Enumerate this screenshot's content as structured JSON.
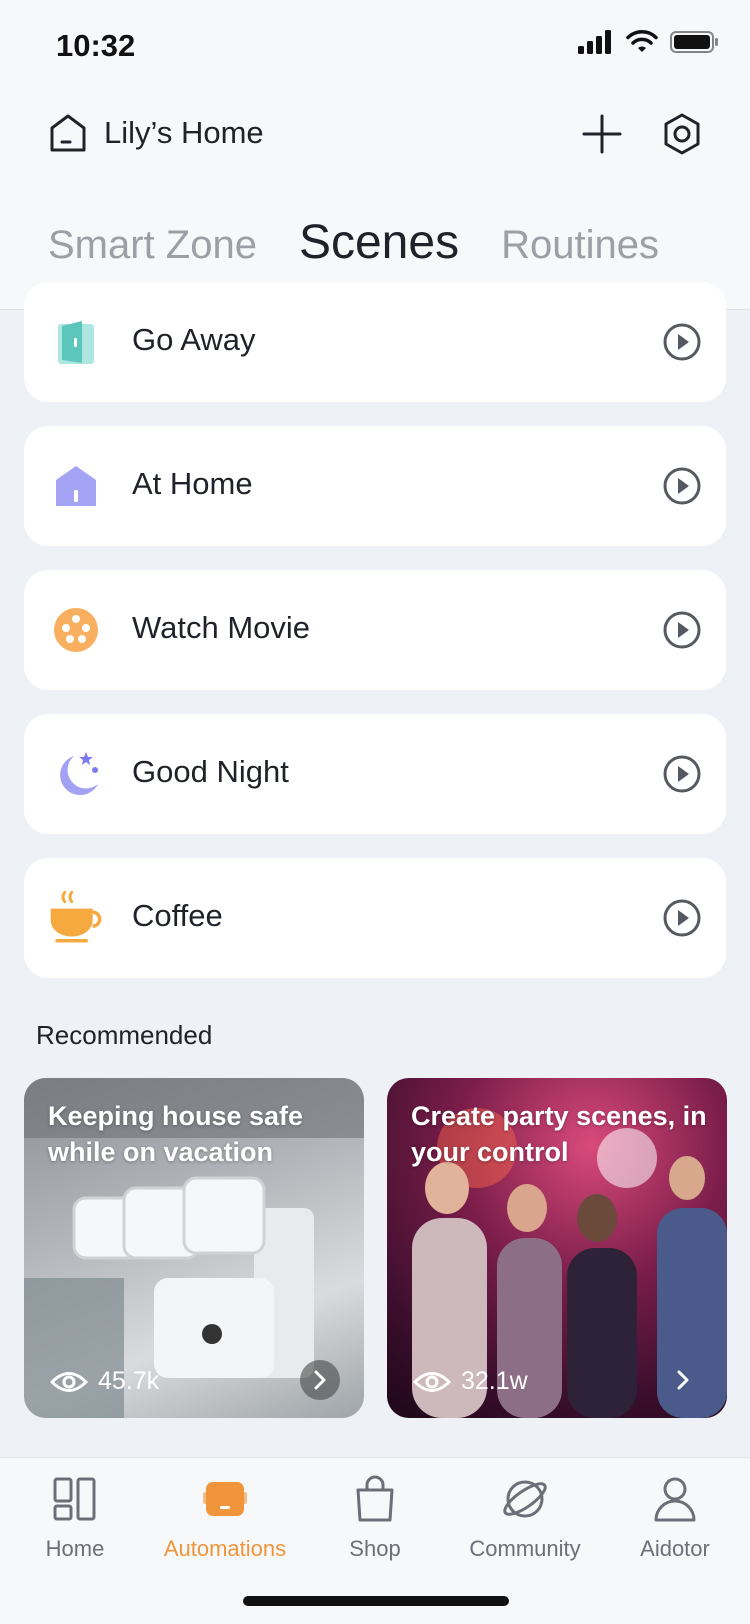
{
  "status": {
    "time": "10:32"
  },
  "header": {
    "home_name": "Lily’s Home",
    "icons": {
      "home": "home-outline-icon",
      "add": "plus-icon",
      "settings": "settings-gear-icon"
    }
  },
  "tabs": [
    {
      "label": "Smart Zone",
      "active": false
    },
    {
      "label": "Scenes",
      "active": true
    },
    {
      "label": "Routines",
      "active": false
    }
  ],
  "scenes": [
    {
      "label": "Go Away",
      "icon": "door-open-icon",
      "color": "#6fcfc7"
    },
    {
      "label": "At Home",
      "icon": "house-icon",
      "color": "#9e9cf0"
    },
    {
      "label": "Watch Movie",
      "icon": "film-reel-icon",
      "color": "#f8b060"
    },
    {
      "label": "Good Night",
      "icon": "moon-stars-icon",
      "color": "#a3a1f3"
    },
    {
      "label": "Coffee",
      "icon": "coffee-cup-icon",
      "color": "#f5a93f"
    }
  ],
  "recommended": {
    "title": "Recommended",
    "cards": [
      {
        "text": "Keeping house safe while on vacation",
        "views": "45.7k"
      },
      {
        "text": "Create party scenes, in your control",
        "views": "32.1w"
      }
    ]
  },
  "bottom_nav": [
    {
      "label": "Home",
      "icon": "dashboard-grid-icon",
      "active": false
    },
    {
      "label": "Automations",
      "icon": "automation-box-icon",
      "active": true
    },
    {
      "label": "Shop",
      "icon": "shopping-bag-icon",
      "active": false
    },
    {
      "label": "Community",
      "icon": "planet-icon",
      "active": false
    },
    {
      "label": "Aidotor",
      "icon": "user-profile-icon",
      "active": false
    }
  ],
  "colors": {
    "accent": "#f0953b",
    "background": "#eef1f5"
  }
}
